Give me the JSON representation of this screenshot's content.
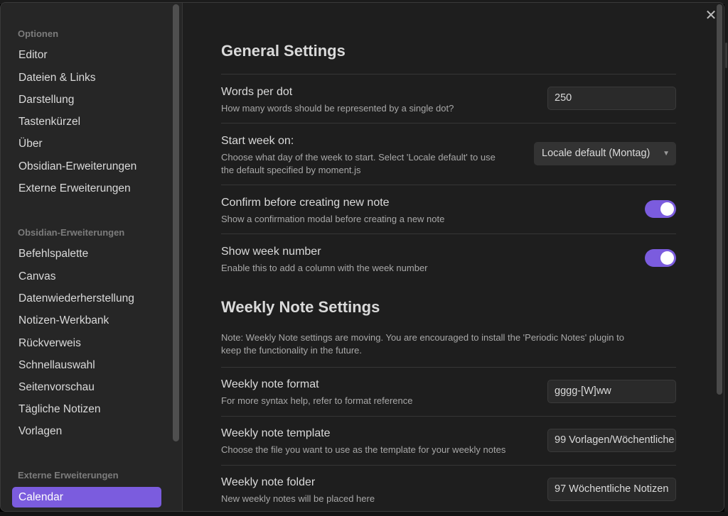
{
  "sidebar": {
    "sections": [
      {
        "heading": "Optionen",
        "items": [
          "Editor",
          "Dateien & Links",
          "Darstellung",
          "Tastenkürzel",
          "Über",
          "Obsidian-Erweiterungen",
          "Externe Erweiterungen"
        ]
      },
      {
        "heading": "Obsidian-Erweiterungen",
        "items": [
          "Befehlspalette",
          "Canvas",
          "Datenwiederherstellung",
          "Notizen-Werkbank",
          "Rückverweis",
          "Schnellauswahl",
          "Seitenvorschau",
          "Tägliche Notizen",
          "Vorlagen"
        ]
      },
      {
        "heading": "Externe Erweiterungen",
        "items": [
          "Calendar"
        ]
      }
    ],
    "active_item": "Calendar"
  },
  "general": {
    "title": "General Settings",
    "words_per_dot": {
      "name": "Words per dot",
      "desc": "How many words should be represented by a single dot?",
      "value": "250"
    },
    "start_week": {
      "name": "Start week on:",
      "desc_line1": "Choose what day of the week to start. Select 'Locale default' to use",
      "desc_line2": "the default specified by moment.js",
      "selected": "Locale default (Montag)"
    },
    "confirm_note": {
      "name": "Confirm before creating new note",
      "desc": "Show a confirmation modal before creating a new note",
      "enabled": true
    },
    "week_number": {
      "name": "Show week number",
      "desc": "Enable this to add a column with the week number",
      "enabled": true
    }
  },
  "weekly": {
    "title": "Weekly Note Settings",
    "note_line1": "Note: Weekly Note settings are moving. You are encouraged to install the 'Periodic Notes' plugin to",
    "note_line2": "keep the functionality in the future.",
    "format": {
      "name": "Weekly note format",
      "desc": "For more syntax help, refer to format reference",
      "value": "gggg-[W]ww"
    },
    "template": {
      "name": "Weekly note template",
      "desc": "Choose the file you want to use as the template for your weekly notes",
      "value": "99 Vorlagen/Wöchentliche"
    },
    "folder": {
      "name": "Weekly note folder",
      "desc": "New weekly notes will be placed here",
      "value": "97 Wöchentliche Notizen"
    }
  },
  "icons": {
    "close": "✕",
    "caret": "▼"
  },
  "colors": {
    "accent": "#7b5cde",
    "background": "#1e1e1e",
    "sidebar": "#262626"
  }
}
